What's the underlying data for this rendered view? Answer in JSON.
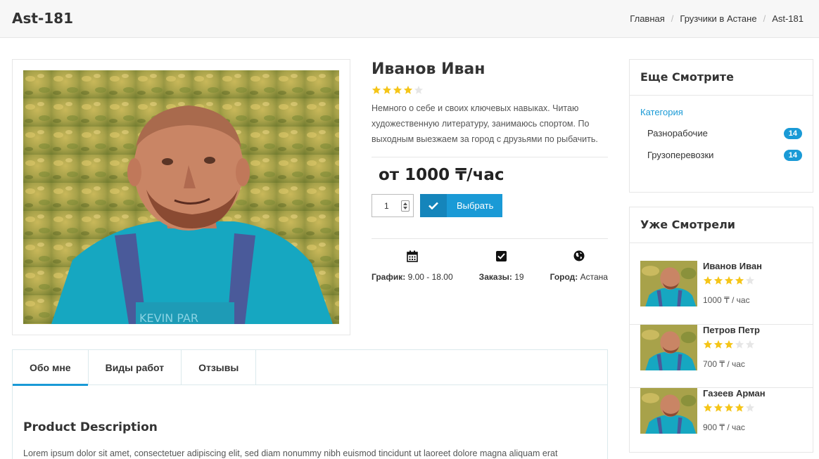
{
  "header": {
    "title": "Ast-181",
    "breadcrumbs": [
      "Главная",
      "Грузчики в Астане",
      "Ast-181"
    ]
  },
  "product": {
    "name": "Иванов Иван",
    "rating": 4,
    "rating_max": 5,
    "description": "Немного о себе и своих ключевых навыках. Читаю художественную литературу, занимаюсь спортом. По выходным выезжаем за город с друзьями по рыбачить.",
    "price": "от 1000 ₸/час",
    "quantity": "1",
    "select_button": "Выбрать",
    "meta": [
      {
        "icon": "calendar-icon",
        "label": "График:",
        "value": "9.00 - 18.00"
      },
      {
        "icon": "checkbox-icon",
        "label": "Заказы:",
        "value": "19"
      },
      {
        "icon": "globe-icon",
        "label": "Город:",
        "value": "Астана"
      }
    ]
  },
  "tabs": {
    "items": [
      "Обо мне",
      "Виды работ",
      "Отзывы"
    ],
    "active": 0,
    "content_title": "Product Description",
    "content_text": "Lorem ipsum dolor sit amet, consectetuer adipiscing elit, sed diam nonummy nibh euismod tincidunt ut laoreet dolore magna aliquam erat"
  },
  "sidebar": {
    "see_also": {
      "title": "Еще Смотрите",
      "category_label": "Категория",
      "categories": [
        {
          "name": "Разнорабочие",
          "count": "14"
        },
        {
          "name": "Грузоперевозки",
          "count": "14"
        }
      ]
    },
    "recently_viewed": {
      "title": "Уже Смотрели",
      "items": [
        {
          "name": "Иванов Иван",
          "rating": 4,
          "price": "1000 ₸ / час"
        },
        {
          "name": "Петров Петр",
          "rating": 3,
          "price": "700 ₸ / час"
        },
        {
          "name": "Газеев Арман",
          "rating": 4,
          "price": "900 ₸ / час"
        }
      ]
    }
  },
  "colors": {
    "accent": "#1a9ad6",
    "star": "#f5c518",
    "star_empty": "#e6e6e6"
  }
}
